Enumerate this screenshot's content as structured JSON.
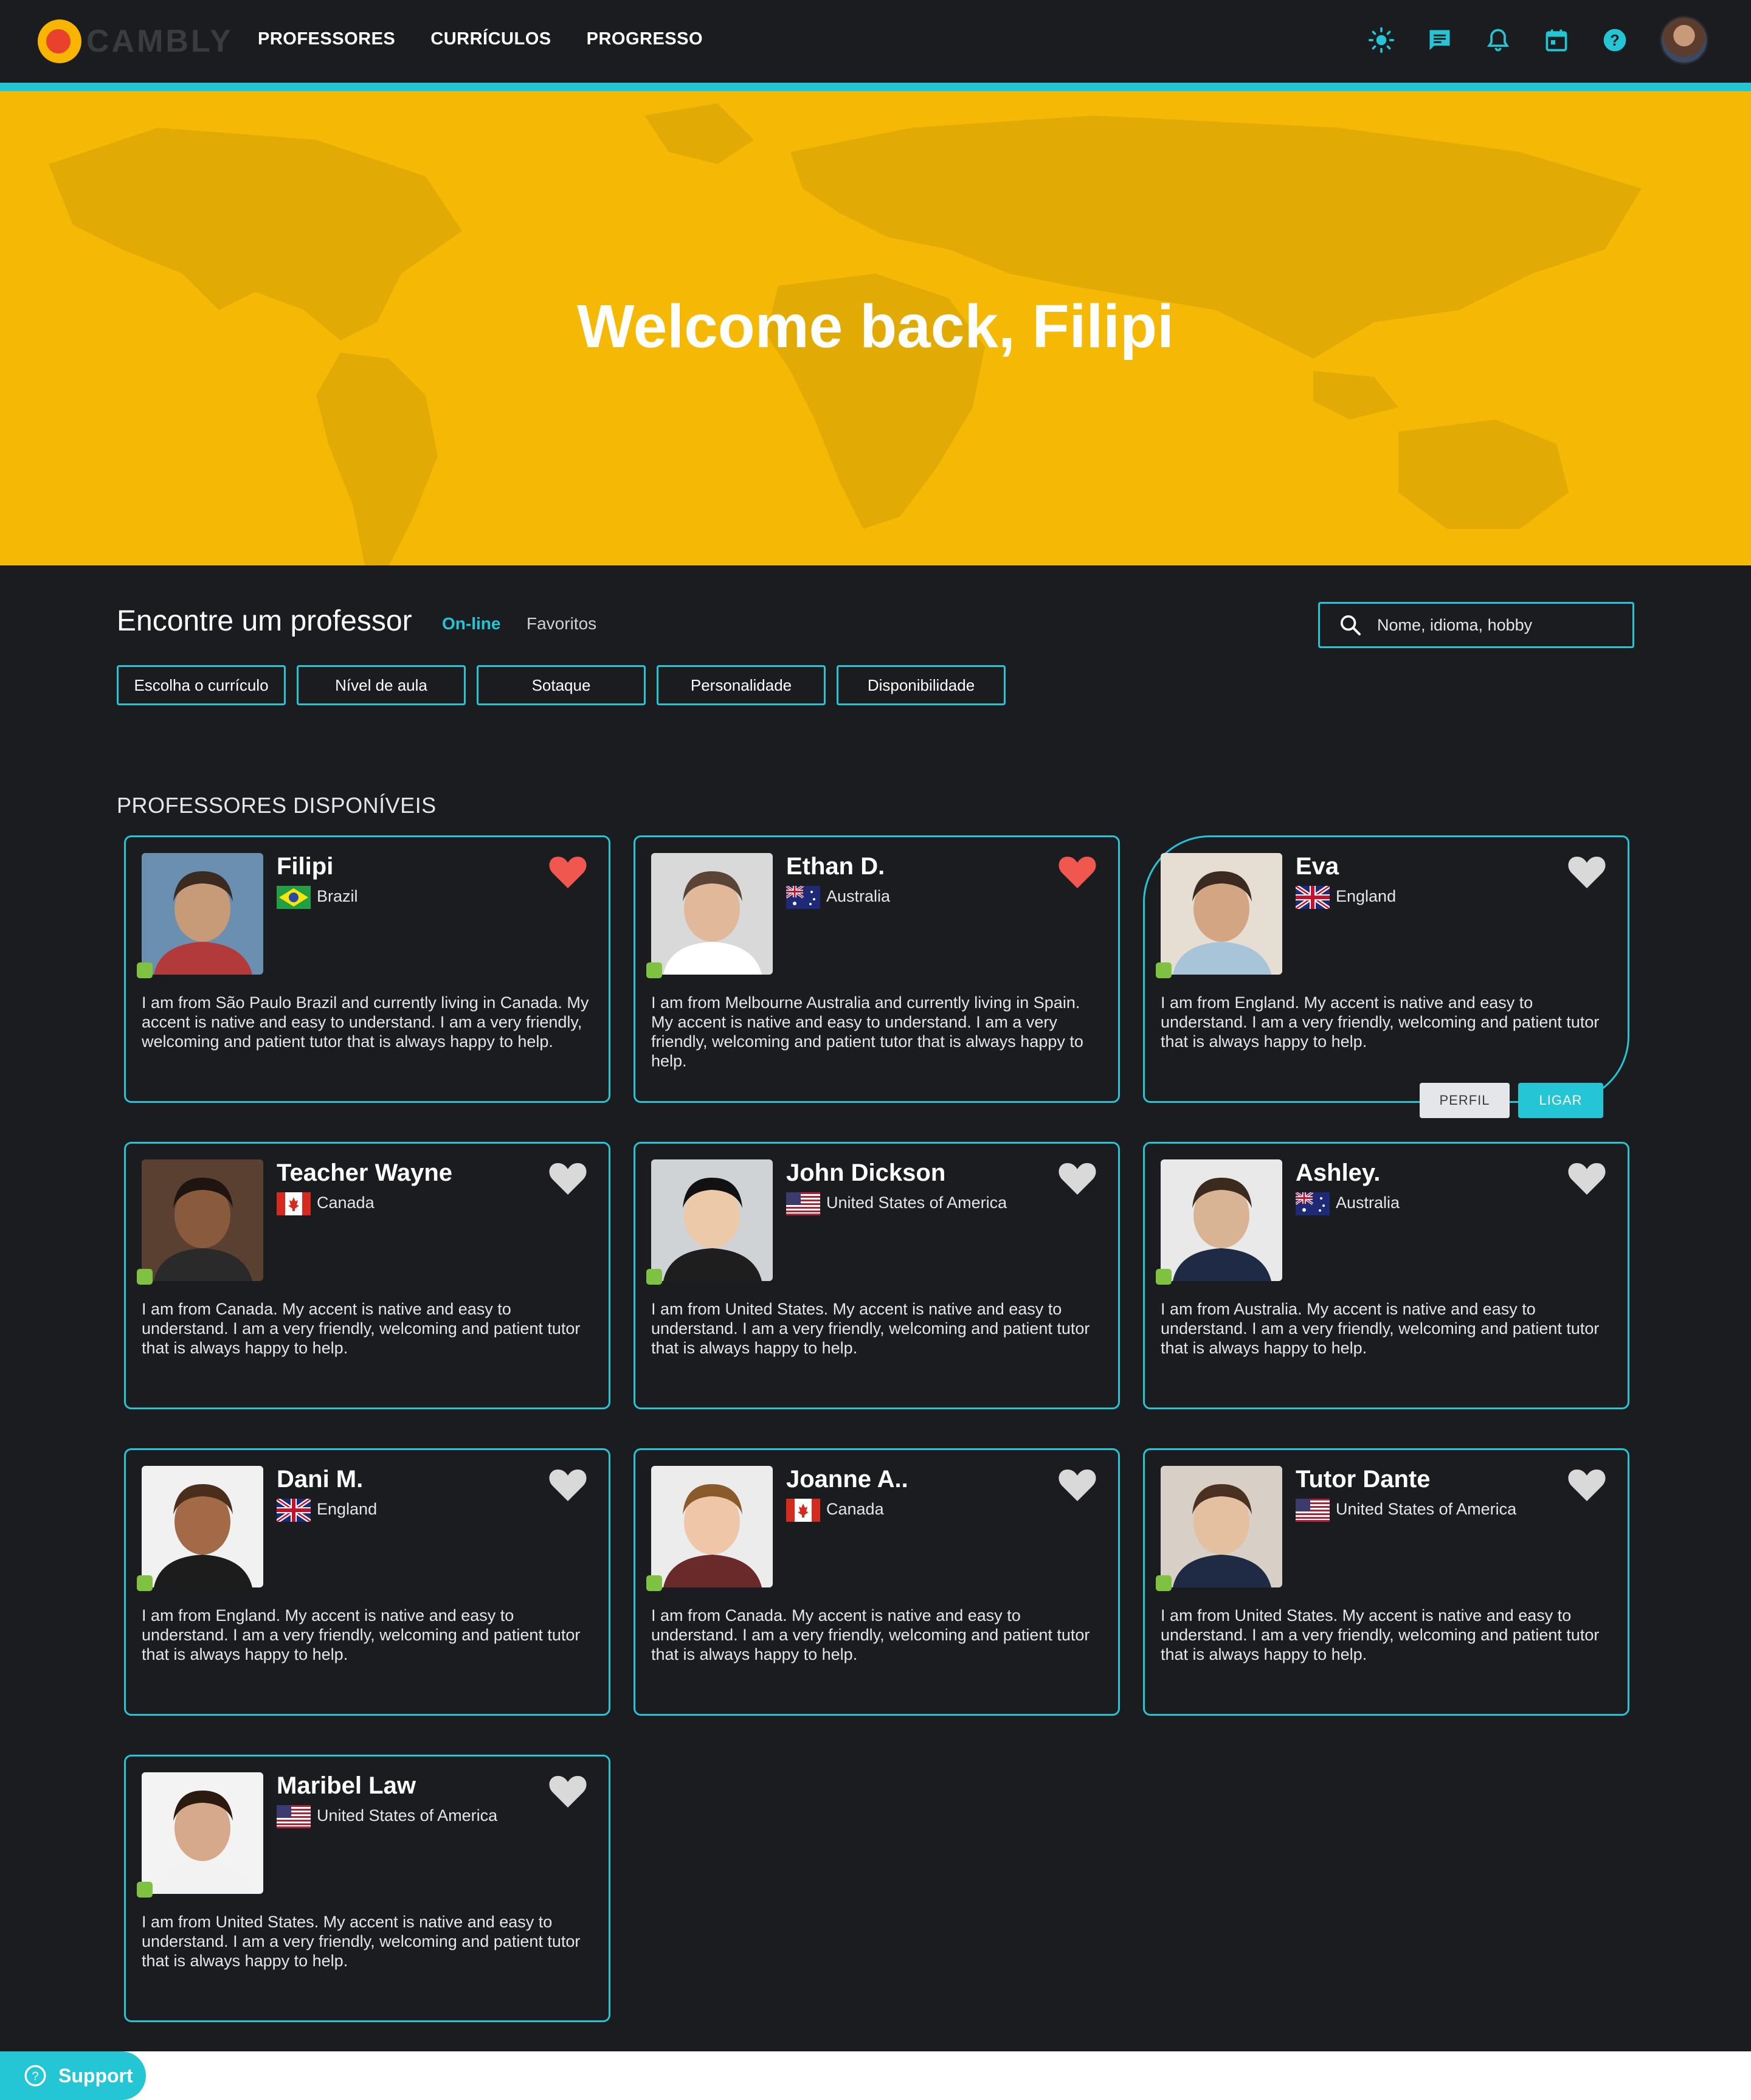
{
  "header": {
    "logo_text": "CAMBLY",
    "nav": [
      "PROFESSORES",
      "CURRÍCULOS",
      "PROGRESSO"
    ]
  },
  "hero": {
    "title": "Welcome back, Filipi"
  },
  "finder": {
    "title": "Encontre um professor",
    "tabs": {
      "online": "On-line",
      "favorites": "Favoritos"
    },
    "search_placeholder": "Nome, idioma, hobby",
    "filters": [
      "Escolha o currículo",
      "Nível de aula",
      "Sotaque",
      "Personalidade",
      "Disponibilidade"
    ]
  },
  "section_title": "PROFESSORES DISPONÍVEIS",
  "card_buttons": {
    "profile": "PERFIL",
    "call": "LIGAR"
  },
  "teachers": [
    {
      "name": "Filipi",
      "country": "Brazil",
      "flag": "brazil-flag",
      "favorite": true,
      "online": true,
      "bio": "I am from São Paulo Brazil and currently living in Canada. My accent is native and easy to understand. I am a very friendly, welcoming and patient tutor that is always happy to help."
    },
    {
      "name": "Ethan D.",
      "country": "Australia",
      "flag": "australia-flag",
      "favorite": true,
      "online": true,
      "bio": "I am from Melbourne Australia and currently living in Spain. My accent is native and easy to understand. I am a very friendly, welcoming and patient tutor that is always happy to help."
    },
    {
      "name": "Eva",
      "country": "England",
      "flag": "uk-flag",
      "favorite": false,
      "online": true,
      "hovered": true,
      "bio": "I am from England. My accent is native and easy to understand. I am a very friendly, welcoming and patient tutor that is always happy to help."
    },
    {
      "name": "Teacher Wayne",
      "country": "Canada",
      "flag": "canada-flag",
      "favorite": false,
      "online": true,
      "bio": "I am from Canada. My accent is native and easy to understand. I am a very friendly, welcoming and patient tutor that is always happy to help."
    },
    {
      "name": "John Dickson",
      "country": "United States of America",
      "flag": "usa-flag",
      "favorite": false,
      "online": true,
      "bio": "I am from United States. My accent is native and easy to understand. I am a very friendly, welcoming and patient tutor that is always happy to help."
    },
    {
      "name": "Ashley.",
      "country": "Australia",
      "flag": "australia-flag",
      "favorite": false,
      "online": true,
      "bio": "I am from Australia. My accent is native and easy to understand. I am a very friendly, welcoming and patient tutor that is always happy to help."
    },
    {
      "name": "Dani M.",
      "country": "England",
      "flag": "uk-flag",
      "favorite": false,
      "online": true,
      "bio": "I am from England. My accent is native and easy to understand. I am a very friendly, welcoming and patient tutor that is always happy to help."
    },
    {
      "name": "Joanne A..",
      "country": "Canada",
      "flag": "canada-flag",
      "favorite": false,
      "online": true,
      "bio": "I am from Canada. My accent is native and easy to understand. I am a very friendly, welcoming and patient tutor that is always happy to help."
    },
    {
      "name": "Tutor Dante",
      "country": "United States of America",
      "flag": "usa-flag",
      "favorite": false,
      "online": true,
      "bio": "I am from United States. My accent is native and easy to understand. I am a very friendly, welcoming and patient tutor that is always happy to help."
    },
    {
      "name": "Maribel Law",
      "country": "United States of America",
      "flag": "usa-flag",
      "favorite": false,
      "online": true,
      "bio": "I am from United States. My accent is native and easy to understand. I am a very friendly, welcoming and patient tutor that is always happy to help."
    }
  ],
  "support": {
    "label": "Support"
  },
  "colors": {
    "accent": "#24c6d6",
    "hero": "#f5b905",
    "heart_active": "#f0584f",
    "heart_inactive": "#d9d9d9",
    "online": "#7fc241"
  }
}
